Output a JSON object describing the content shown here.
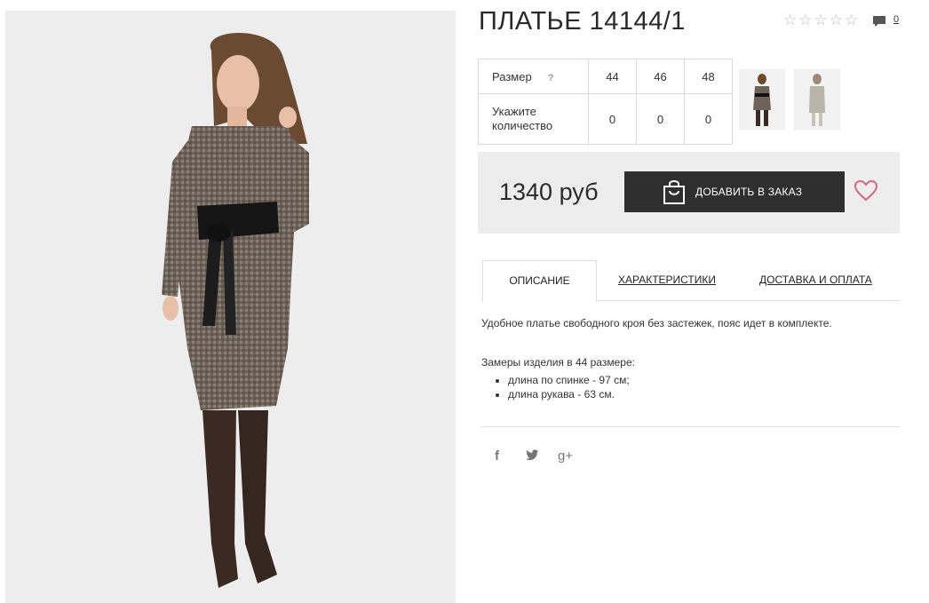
{
  "product": {
    "title": "ПЛАТЬЕ 14144/1",
    "rating_stars": 0,
    "comments_count": "0"
  },
  "sizes_table": {
    "size_label": "Размер",
    "help_mark": "?",
    "sizes": [
      "44",
      "46",
      "48"
    ],
    "qty_label": "Укажите количество",
    "quantities": [
      "0",
      "0",
      "0"
    ]
  },
  "purchase": {
    "price": "1340 руб",
    "add_button_label": "ДОБАВИТЬ В ЗАКАЗ"
  },
  "tabs": [
    {
      "label": "ОПИСАНИЕ"
    },
    {
      "label": "ХАРАКТЕРИСТИКИ"
    },
    {
      "label": "ДОСТАВКА И ОПЛАТА"
    }
  ],
  "description": {
    "text": "Удобное платье свободного кроя без застежек, пояс идет в комплекте.",
    "measurements_title": "Замеры изделия в 44 размере:",
    "measurements": [
      "длина по спинке - 97 см;",
      "длина рукава - 63 см."
    ]
  },
  "social": [
    "f",
    "t",
    "g+"
  ],
  "colors": {
    "button_bg": "#2f2f2f",
    "heart": "#d36b7f",
    "panel_bg": "#ededed"
  }
}
